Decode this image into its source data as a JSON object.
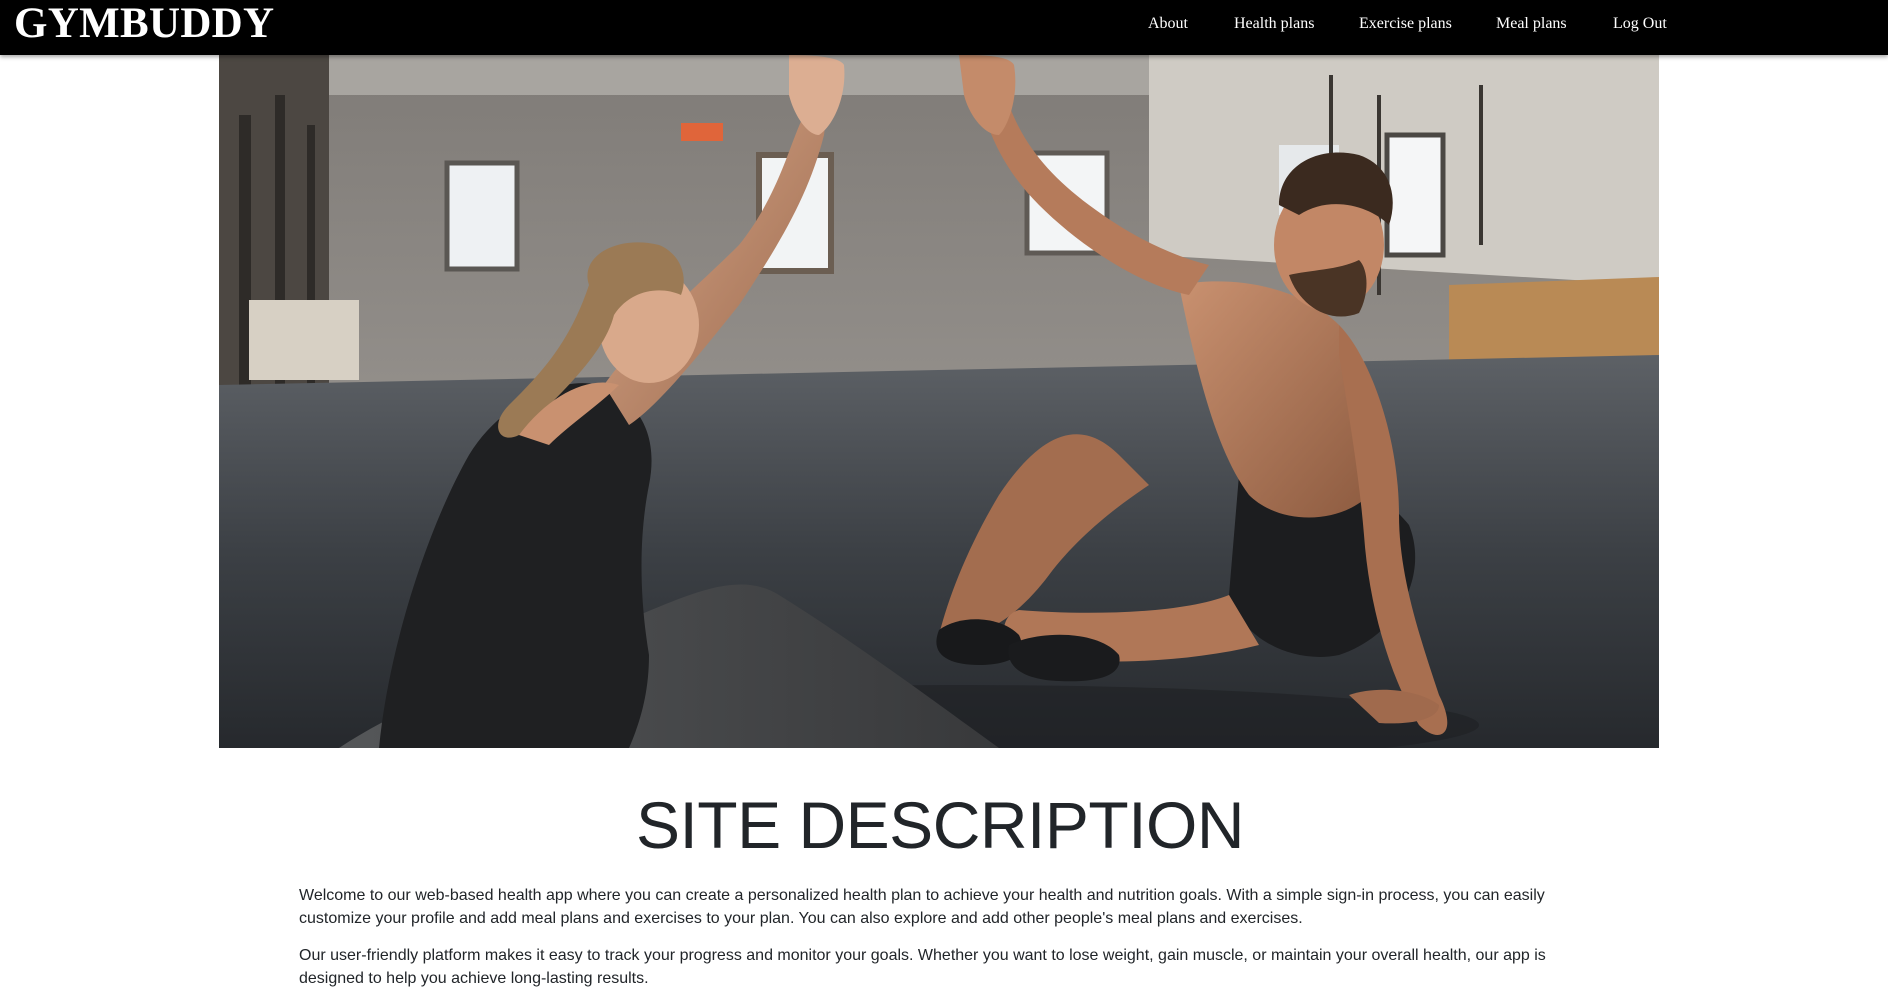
{
  "nav": {
    "brand": "GYMBUDDY",
    "links": [
      {
        "label": "About"
      },
      {
        "label": "Health plans"
      },
      {
        "label": "Exercise plans"
      },
      {
        "label": "Meal plans"
      },
      {
        "label": "Log Out"
      }
    ]
  },
  "hero": {
    "subject": "Man and woman sitting on a gym floor giving each other a high five"
  },
  "main": {
    "title": "SITE DESCRIPTION",
    "paragraphs": [
      "Welcome to our web-based health app where you can create a personalized health plan to achieve your health and nutrition goals. With a simple sign-in process, you can easily customize your profile and add meal plans and exercises to your plan. You can also explore and add other people's meal plans and exercises.",
      "Our user-friendly platform makes it easy to track your progress and monitor your goals. Whether you want to lose weight, gain muscle, or maintain your overall health, our app is designed to help you achieve long-lasting results."
    ]
  },
  "colors": {
    "navbar_bg": "#000000",
    "nav_text": "#ffffff",
    "body_text": "#212529"
  }
}
